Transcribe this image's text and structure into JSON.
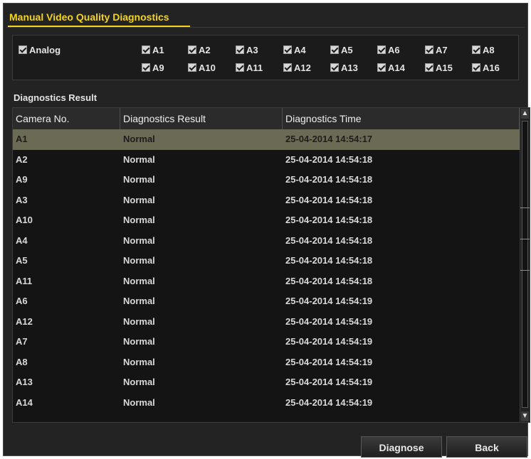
{
  "window": {
    "title": "Manual Video Quality Diagnostics"
  },
  "analog": {
    "label": "Analog",
    "cameras": [
      "A1",
      "A2",
      "A3",
      "A4",
      "A5",
      "A6",
      "A7",
      "A8",
      "A9",
      "A10",
      "A11",
      "A12",
      "A13",
      "A14",
      "A15",
      "A16"
    ]
  },
  "results": {
    "section_label": "Diagnostics Result",
    "columns": [
      "Camera No.",
      "Diagnostics Result",
      "Diagnostics Time"
    ],
    "rows": [
      [
        "A1",
        "Normal",
        "25-04-2014 14:54:17"
      ],
      [
        "A2",
        "Normal",
        "25-04-2014 14:54:18"
      ],
      [
        "A9",
        "Normal",
        "25-04-2014 14:54:18"
      ],
      [
        "A3",
        "Normal",
        "25-04-2014 14:54:18"
      ],
      [
        "A10",
        "Normal",
        "25-04-2014 14:54:18"
      ],
      [
        "A4",
        "Normal",
        "25-04-2014 14:54:18"
      ],
      [
        "A5",
        "Normal",
        "25-04-2014 14:54:18"
      ],
      [
        "A11",
        "Normal",
        "25-04-2014 14:54:18"
      ],
      [
        "A6",
        "Normal",
        "25-04-2014 14:54:19"
      ],
      [
        "A12",
        "Normal",
        "25-04-2014 14:54:19"
      ],
      [
        "A7",
        "Normal",
        "25-04-2014 14:54:19"
      ],
      [
        "A8",
        "Normal",
        "25-04-2014 14:54:19"
      ],
      [
        "A13",
        "Normal",
        "25-04-2014 14:54:19"
      ],
      [
        "A14",
        "Normal",
        "25-04-2014 14:54:19"
      ]
    ],
    "selected_row": 0
  },
  "buttons": {
    "diagnose": "Diagnose",
    "back": "Back"
  },
  "icons": {
    "checkbox": "checkbox-checked-icon",
    "scroll_up": "chevron-up-icon",
    "scroll_down": "chevron-down-icon"
  },
  "colors": {
    "title": "#f2d41e",
    "selected_row": "#6b6a55",
    "background": "#232323"
  }
}
